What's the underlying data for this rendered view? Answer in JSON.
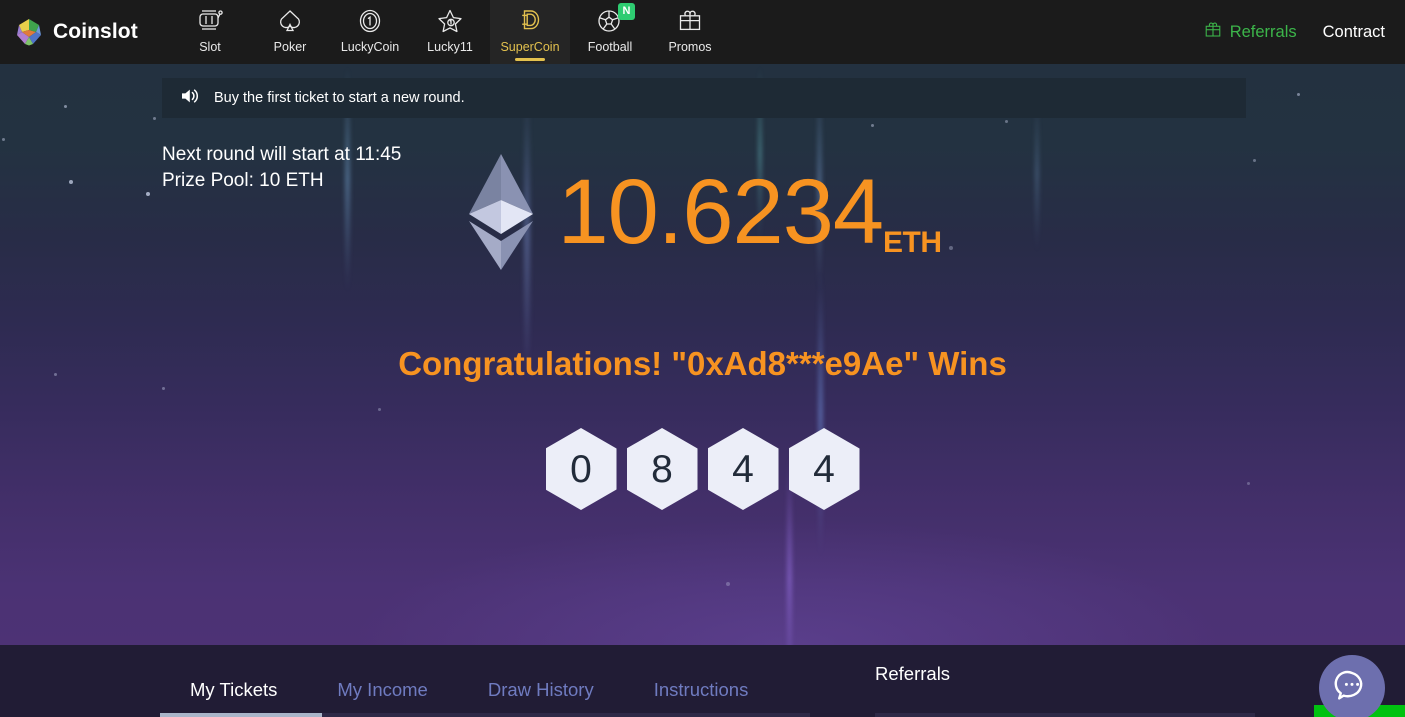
{
  "brand": {
    "name": "Coinslot",
    "logo_icon": "polyhedron-logo-icon"
  },
  "nav": {
    "items": [
      {
        "label": "Slot",
        "icon": "slot-machine-icon",
        "active": false,
        "badge": ""
      },
      {
        "label": "Poker",
        "icon": "spade-icon",
        "active": false,
        "badge": ""
      },
      {
        "label": "LuckyCoin",
        "icon": "coin-one-icon",
        "active": false,
        "badge": ""
      },
      {
        "label": "Lucky11",
        "icon": "star-icon",
        "active": false,
        "badge": ""
      },
      {
        "label": "SuperCoin",
        "icon": "supercoin-d-icon",
        "active": true,
        "badge": ""
      },
      {
        "label": "Football",
        "icon": "football-icon",
        "active": false,
        "badge": "N"
      },
      {
        "label": "Promos",
        "icon": "gift-icon",
        "active": false,
        "badge": ""
      }
    ],
    "right": [
      {
        "label": "Referrals",
        "icon": "gift-icon",
        "color": "#3cb54a"
      },
      {
        "label": "Contract",
        "icon": "",
        "color": "#ffffff"
      }
    ]
  },
  "announcement": {
    "icon": "speaker-icon",
    "text": "Buy the first ticket to start a new round."
  },
  "hero": {
    "next_round": "Next round will start at 11:45",
    "prize_pool": "Prize Pool: 10 ETH",
    "eth_icon": "ethereum-diamond-icon",
    "amount": "10.6234",
    "unit": "ETH",
    "congrats": "Congratulations! \"0xAd8***e9Ae\" Wins",
    "winning_numbers": [
      "0",
      "8",
      "4",
      "4"
    ],
    "accent_color": "#f79321"
  },
  "bottom": {
    "tabs": [
      {
        "label": "My Tickets",
        "active": true
      },
      {
        "label": "My Income",
        "active": false
      },
      {
        "label": "Draw History",
        "active": false
      },
      {
        "label": "Instructions",
        "active": false
      }
    ],
    "referrals_title": "Referrals"
  },
  "chat": {
    "icon": "chat-bubble-icon"
  }
}
